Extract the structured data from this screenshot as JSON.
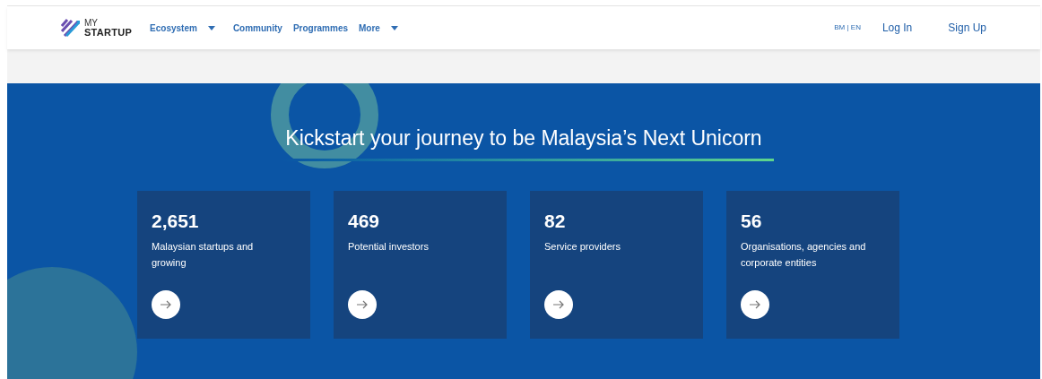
{
  "header": {
    "logo": {
      "line1": "MY",
      "line2": "STARTUP"
    },
    "nav": [
      {
        "label": "Ecosystem",
        "dropdown": true
      },
      {
        "label": "Community",
        "dropdown": false
      },
      {
        "label": "Programmes",
        "dropdown": false
      },
      {
        "label": "More",
        "dropdown": true
      }
    ],
    "language": "BM | EN",
    "login": "Log In",
    "signup": "Sign Up"
  },
  "hero": {
    "title": "Kickstart your journey to be Malaysia’s Next Unicorn",
    "stats": [
      {
        "value": "2,651",
        "label": "Malaysian startups and growing"
      },
      {
        "value": "469",
        "label": "Potential investors"
      },
      {
        "value": "82",
        "label": "Service providers"
      },
      {
        "value": "56",
        "label": "Organisations, agencies and corporate entities"
      }
    ]
  }
}
